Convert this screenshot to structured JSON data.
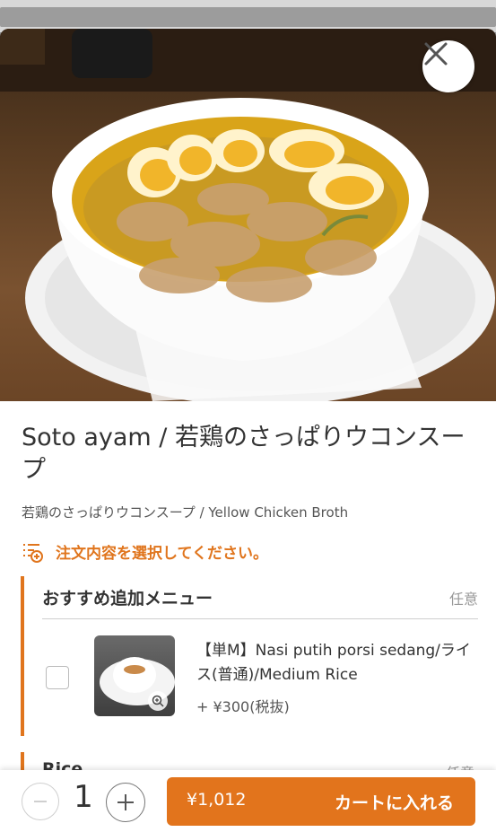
{
  "dish": {
    "title": "Soto ayam / 若鶏のさっぱりウコンスープ",
    "subtitle": "若鶏のさっぱりウコンスープ / Yellow Chicken Broth"
  },
  "notice": {
    "text": "注文内容を選択してください。",
    "icon": "list-plus-icon"
  },
  "option_groups": [
    {
      "title": "おすすめ追加メニュー",
      "optional_label": "任意",
      "items": [
        {
          "name": "【単M】Nasi putih porsi sedang/ライス(普通)/Medium Rice",
          "price": "+ ¥300(税抜)",
          "checked": false
        }
      ]
    },
    {
      "title": "Rice",
      "optional_label": "任意"
    }
  ],
  "footer": {
    "quantity": "1",
    "cart_price": "¥1,012",
    "cart_label": "カートに入れる"
  },
  "colors": {
    "accent": "#e2741c",
    "text": "#333333"
  }
}
